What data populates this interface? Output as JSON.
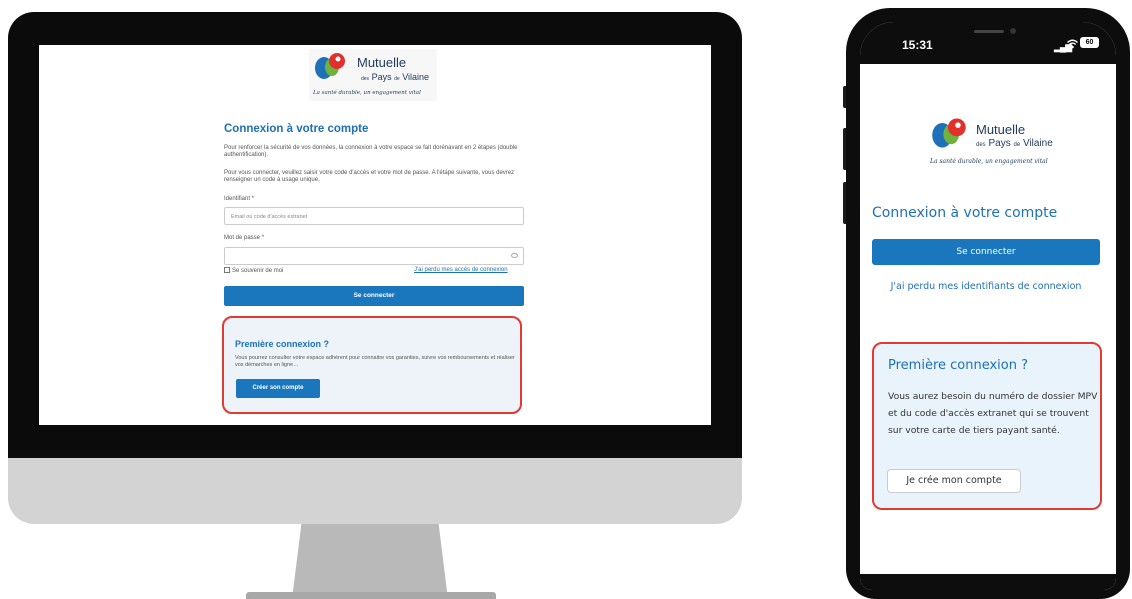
{
  "brand": {
    "name_line1": "Mutuelle",
    "name_line2_prefix": "des",
    "name_line2_pays": "Pays",
    "name_line2_de": "de",
    "name_line2_vilaine": "Vilaine",
    "tagline": "La santé durable, un engagement vital"
  },
  "desktop": {
    "title": "Connexion à votre compte",
    "intro_1": "Pour renforcer la sécurité de vos données, la connexion à votre espace se fait dorénavant en 2 étapes (double authentification).",
    "intro_2": "Pour vous connecter, veuillez saisir votre code d'accès et votre mot de passe. A l'étape suivante, vous devrez renseigner un code à usage unique.",
    "identifiant_label": "Identifiant *",
    "identifiant_placeholder": "Email ou code d'accès extranet",
    "password_label": "Mot de passe *",
    "remember_label": "Se souvenir de moi",
    "forgot_link": "J'ai perdu mes accès de connexion",
    "login_button": "Se connecter",
    "first_login": {
      "title": "Première connexion ?",
      "text": "Vous pourrez consulter votre espace adhérent pour connaitre vos garanties, suivre vos remboursements et réaliser vos démarches en ligne…",
      "button": "Créer son compte"
    }
  },
  "phone": {
    "status": {
      "time": "15:31",
      "battery": "60"
    },
    "title": "Connexion à votre compte",
    "login_button": "Se connecter",
    "forgot_link": "J'ai perdu mes identifiants de connexion",
    "first_login": {
      "title": "Première connexion ?",
      "text": "Vous aurez besoin du numéro de dossier MPV et du code d'accès extranet qui se trouvent sur votre carte de tiers payant santé.",
      "button": "Je crée mon compte"
    }
  },
  "colors": {
    "primary_blue": "#1a77bd",
    "title_blue": "#1e70b8",
    "highlight_red": "#e03a33",
    "box_bg": "#eef3f9"
  }
}
